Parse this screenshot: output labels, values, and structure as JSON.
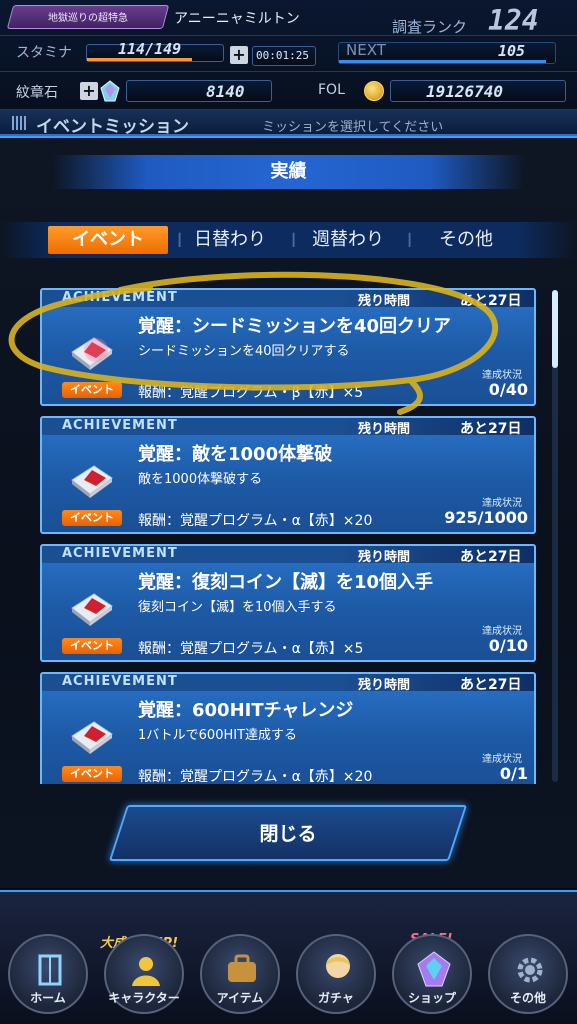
{
  "header": {
    "event_badge": "地獄巡りの超特急",
    "player_name": "アニーニャミルトン",
    "rank_label": "調査ランク",
    "rank_value": "124",
    "stamina_label": "スタミナ",
    "stamina_value": "114/149",
    "stamina_timer": "00:01:25",
    "next_label": "NEXT",
    "next_value": "105",
    "crest_label": "紋章石",
    "crest_value": "8140",
    "fol_label": "FOL",
    "fol_value": "19126740"
  },
  "title_bar": {
    "title": "イベントミッション",
    "hint": "ミッションを選択してください"
  },
  "panel": {
    "section_title": "実績",
    "tabs": [
      {
        "label": "イベント",
        "active": true
      },
      {
        "label": "日替わり",
        "active": false
      },
      {
        "label": "週替わり",
        "active": false
      },
      {
        "label": "その他",
        "active": false
      }
    ]
  },
  "missions": [
    {
      "header": "ACHIEVEMENT",
      "remain_label": "残り時間",
      "remain_value": "あと27日",
      "title": "覚醒：シードミッションを40回クリア",
      "desc": "シードミッションを40回クリアする",
      "badge": "イベント",
      "reward": "報酬：覚醒プログラム・β【赤】×5",
      "progress_label": "達成状況",
      "progress": "0/40"
    },
    {
      "header": "ACHIEVEMENT",
      "remain_label": "残り時間",
      "remain_value": "あと27日",
      "title": "覚醒：敵を1000体撃破",
      "desc": "敵を1000体撃破する",
      "badge": "イベント",
      "reward": "報酬：覚醒プログラム・α【赤】×20",
      "progress_label": "達成状況",
      "progress": "925/1000"
    },
    {
      "header": "ACHIEVEMENT",
      "remain_label": "残り時間",
      "remain_value": "あと27日",
      "title": "覚醒：復刻コイン【滅】を10個入手",
      "desc": "復刻コイン【滅】を10個入手する",
      "badge": "イベント",
      "reward": "報酬：覚醒プログラム・α【赤】×5",
      "progress_label": "達成状況",
      "progress": "0/10"
    },
    {
      "header": "ACHIEVEMENT",
      "remain_label": "残り時間",
      "remain_value": "あと27日",
      "title": "覚醒：600HITチャレンジ",
      "desc": "1バトルで600HIT達成する",
      "badge": "イベント",
      "reward": "報酬：覚醒プログラム・α【赤】×20",
      "progress_label": "達成状況",
      "progress": "0/1"
    }
  ],
  "close_label": "閉じる",
  "footer": {
    "banner_left": "大成功率UP!",
    "banner_right": "SALE!",
    "nav": [
      {
        "label": "ホーム",
        "icon": "home-icon"
      },
      {
        "label": "キャラクター",
        "icon": "character-icon"
      },
      {
        "label": "アイテム",
        "icon": "item-bag-icon"
      },
      {
        "label": "ガチャ",
        "icon": "gacha-icon"
      },
      {
        "label": "ショップ",
        "icon": "shop-crystal-icon"
      },
      {
        "label": "その他",
        "icon": "gear-icon"
      }
    ]
  },
  "colors": {
    "accent": "#2f8cff",
    "tab_active": "#f47a0c",
    "card": "#2468bd"
  }
}
